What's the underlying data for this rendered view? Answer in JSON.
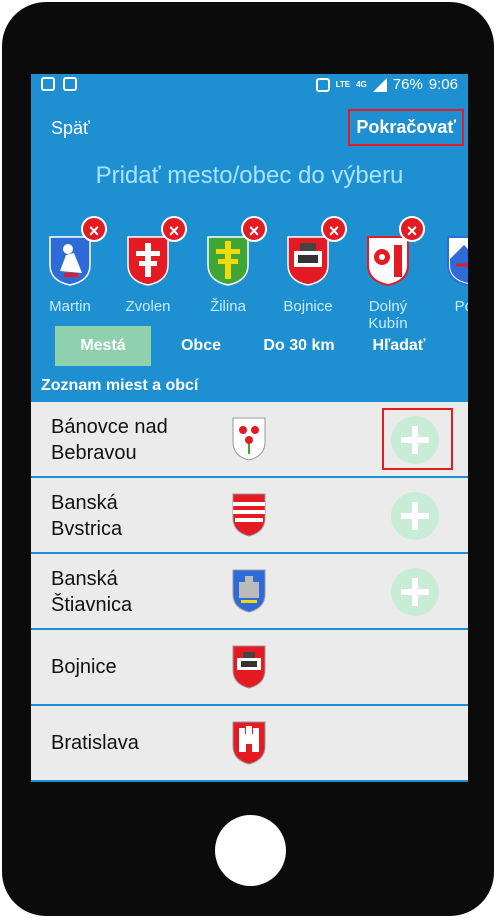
{
  "status": {
    "battery": "76%",
    "time": "9:06",
    "network": "4G",
    "volte": "LTE"
  },
  "topbar": {
    "back_label": "Späť",
    "continue_label": "Pokračovať"
  },
  "title": "Pridať mesto/obec do výberu",
  "selected": [
    {
      "name": "Martin",
      "crest": "martin-crest"
    },
    {
      "name": "Zvolen",
      "crest": "zvolen-crest"
    },
    {
      "name": "Žilina",
      "crest": "zilina-crest"
    },
    {
      "name": "Bojnice",
      "crest": "bojnice-crest"
    },
    {
      "name": "Dolný Kubín",
      "crest": "dolny-kubin-crest"
    },
    {
      "name": "Pop",
      "crest": "poprad-crest"
    }
  ],
  "tabs": [
    {
      "label": "Mestá",
      "active": true
    },
    {
      "label": "Obce",
      "active": false
    },
    {
      "label": "Do 30 km",
      "active": false
    },
    {
      "label": "Hľadať",
      "active": false
    }
  ],
  "list": {
    "header": "Zoznam miest a obcí",
    "rows": [
      {
        "line1": "Bánovce nad",
        "line2": "Bebravou",
        "add": true
      },
      {
        "line1": "Banská",
        "line2": "Bvstrica",
        "add": true
      },
      {
        "line1": "Banská",
        "line2": "Štiavnica",
        "add": true
      },
      {
        "line1": "Bojnice",
        "line2": "",
        "add": false
      },
      {
        "line1": "Bratislava",
        "line2": "",
        "add": false
      }
    ]
  },
  "colors": {
    "primary": "#1e90d2",
    "accent_red": "#e41b23",
    "tab_active": "#8fd0ae",
    "add_button": "#c9ecd7"
  }
}
